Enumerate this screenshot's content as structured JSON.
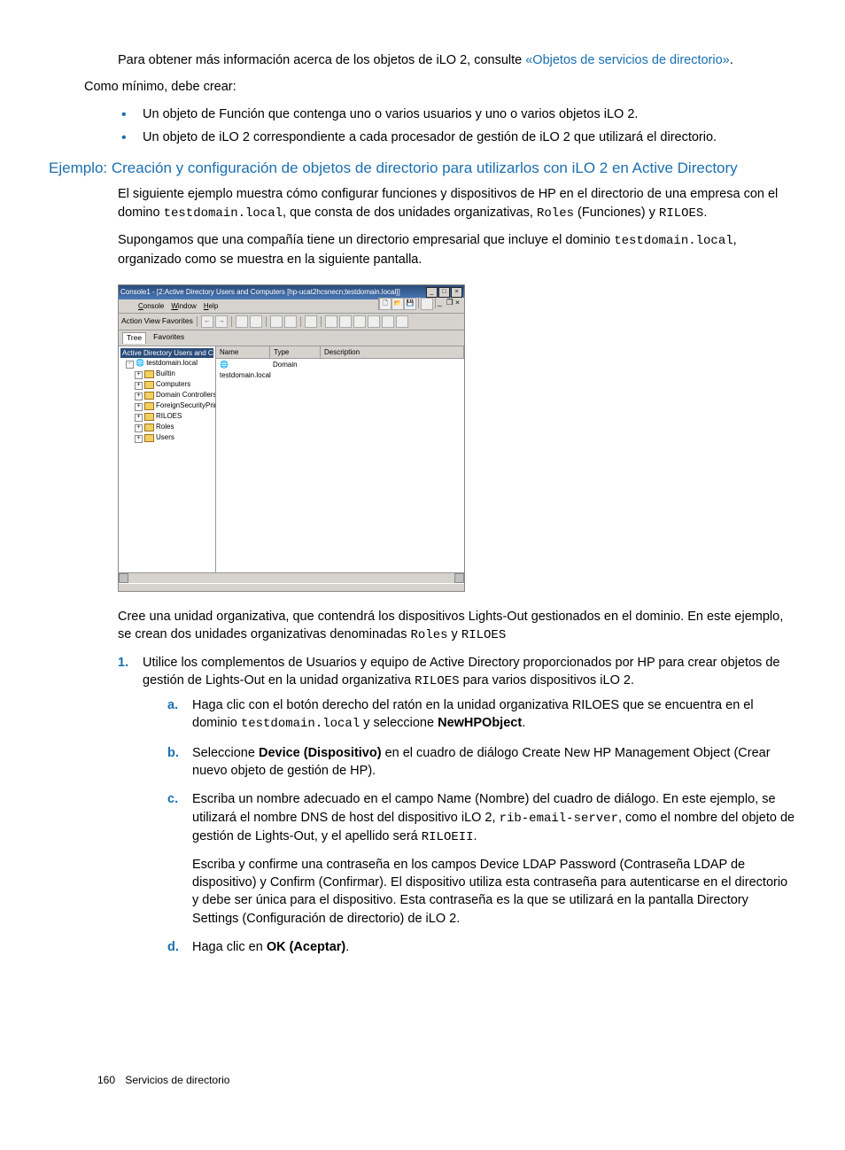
{
  "intro_para": "Para obtener más información acerca de los objetos de iLO 2, consulte ",
  "intro_link": "«Objetos de servicios de directorio»",
  "intro_end": ".",
  "minimum": "Como mínimo, debe crear:",
  "bullet1": "Un objeto de Función que contenga uno o varios usuarios y uno o varios objetos iLO 2.",
  "bullet2": "Un objeto de iLO 2 correspondiente a cada procesador de gestión de iLO 2 que utilizará el directorio.",
  "heading": "Ejemplo: Creación y configuración de objetos de directorio para utilizarlos con iLO 2 en Active Directory",
  "p1a": "El siguiente ejemplo muestra cómo configurar funciones y dispositivos de HP en el directorio de una empresa con el domino ",
  "p1_code": "testdomain.local",
  "p1b": ", que consta de dos unidades organizativas, ",
  "p1_code2": "Roles",
  "p1c": " (Funciones) y ",
  "p1_code3": "RILOES",
  "p1d": ".",
  "p2a": "Supongamos que una compañía tiene un directorio empresarial que incluye el dominio ",
  "p2_code": "testdomain.local",
  "p2b": ", organizado como se muestra en la siguiente pantalla.",
  "screenshot": {
    "title": "Console1 - [2:Active Directory Users and Computers [hp-ucat2hcsnecn;testdomain.local]]",
    "menu": [
      "Console",
      "Window",
      "Help"
    ],
    "barmenu": [
      "Action",
      "View",
      "Favorites"
    ],
    "tabs": [
      "Tree",
      "Favorites"
    ],
    "root": "Active Directory Users and Computers",
    "domain": "testdomain.local",
    "nodes": [
      "Builtin",
      "Computers",
      "Domain Controllers",
      "ForeignSecurityPrincipals",
      "RILOES",
      "Roles",
      "Users"
    ],
    "cols": [
      "Name",
      "Type",
      "Description"
    ],
    "row_name": "testdomain.local",
    "row_type": "Domain"
  },
  "p3a": "Cree una unidad organizativa, que contendrá los dispositivos Lights-Out gestionados en el dominio. En este ejemplo, se crean dos unidades organizativas denominadas ",
  "p3_code1": "Roles",
  "p3b": " y ",
  "p3_code2": "RILOES",
  "steps": {
    "n1": "1.",
    "s1a": "Utilice los complementos de Usuarios y equipo de Active Directory proporcionados por HP para crear objetos de gestión de Lights-Out en la unidad organizativa ",
    "s1code": "RILOES",
    "s1b": " para varios dispositivos iLO 2.",
    "a": {
      "m": "a.",
      "t1": "Haga clic con el botón derecho del ratón en la unidad organizativa RILOES que se encuentra en el dominio ",
      "c1": "testdomain.local",
      "t2": " y seleccione ",
      "bold": "NewHPObject",
      "t3": "."
    },
    "b": {
      "m": "b.",
      "t1": "Seleccione ",
      "bold": "Device (Dispositivo)",
      "t2": " en el cuadro de diálogo Create New HP Management Object (Crear nuevo objeto de gestión de HP)."
    },
    "c": {
      "m": "c.",
      "t1": "Escriba un nombre adecuado en el campo Name (Nombre) del cuadro de diálogo. En este ejemplo, se utilizará el nombre DNS de host del dispositivo iLO 2, ",
      "c1": "rib-email-server",
      "t2": ", como el nombre del objeto de gestión de Lights-Out, y el apellido será ",
      "c2": "RILOEII",
      "t3": ".",
      "p2": "Escriba y confirme una contraseña en los campos Device LDAP Password (Contraseña LDAP de dispositivo) y Confirm (Confirmar). El dispositivo utiliza esta contraseña para autenticarse en el directorio y debe ser única para el dispositivo. Esta contraseña es la que se utilizará en la pantalla Directory Settings (Configuración de directorio) de iLO 2."
    },
    "d": {
      "m": "d.",
      "t1": "Haga clic en ",
      "bold": "OK (Aceptar)",
      "t2": "."
    }
  },
  "footer": {
    "page": "160",
    "section": "Servicios de directorio"
  }
}
